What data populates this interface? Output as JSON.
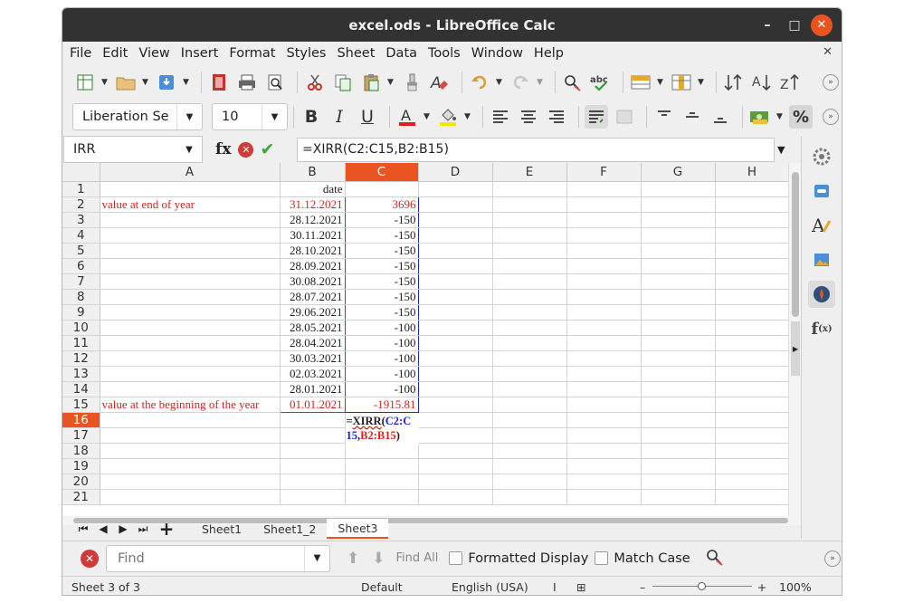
{
  "window": {
    "title": "excel.ods - LibreOffice Calc",
    "minimize": "–",
    "maximize": "□",
    "close": "✕"
  },
  "menu": {
    "items": [
      "File",
      "Edit",
      "View",
      "Insert",
      "Format",
      "Styles",
      "Sheet",
      "Data",
      "Tools",
      "Window",
      "Help"
    ],
    "close": "✕"
  },
  "format_toolbar": {
    "font_name": "Liberation Se",
    "font_size": "10",
    "bold": "B",
    "italic": "I",
    "underline": "U",
    "percent": "%"
  },
  "formula_bar": {
    "name_box": "IRR",
    "fx": "fx",
    "formula": "=XIRR(C2:C15,B2:B15)"
  },
  "grid": {
    "columns": [
      "A",
      "B",
      "C",
      "D",
      "E",
      "F",
      "G",
      "H"
    ],
    "active_column": "C",
    "active_row": "16",
    "rows": [
      {
        "n": "1",
        "a": "",
        "b": "date",
        "c": ""
      },
      {
        "n": "2",
        "a": "value at end of year",
        "b": "31.12.2021",
        "c": "3696"
      },
      {
        "n": "3",
        "a": "",
        "b": "28.12.2021",
        "c": "-150"
      },
      {
        "n": "4",
        "a": "",
        "b": "30.11.2021",
        "c": "-150"
      },
      {
        "n": "5",
        "a": "",
        "b": "28.10.2021",
        "c": "-150"
      },
      {
        "n": "6",
        "a": "",
        "b": "28.09.2021",
        "c": "-150"
      },
      {
        "n": "7",
        "a": "",
        "b": "30.08.2021",
        "c": "-150"
      },
      {
        "n": "8",
        "a": "",
        "b": "28.07.2021",
        "c": "-150"
      },
      {
        "n": "9",
        "a": "",
        "b": "29.06.2021",
        "c": "-150"
      },
      {
        "n": "10",
        "a": "",
        "b": "28.05.2021",
        "c": "-100"
      },
      {
        "n": "11",
        "a": "",
        "b": "28.04.2021",
        "c": "-100"
      },
      {
        "n": "12",
        "a": "",
        "b": "30.03.2021",
        "c": "-100"
      },
      {
        "n": "13",
        "a": "",
        "b": "02.03.2021",
        "c": "-100"
      },
      {
        "n": "14",
        "a": "",
        "b": "28.01.2021",
        "c": "-100"
      },
      {
        "n": "15",
        "a": "value at the beginning of the year",
        "b": "01.01.2021",
        "c": "-1915.81"
      },
      {
        "n": "16",
        "a": "",
        "b": "",
        "c": ""
      },
      {
        "n": "17",
        "a": "",
        "b": "",
        "c": ""
      },
      {
        "n": "18",
        "a": "",
        "b": "",
        "c": ""
      },
      {
        "n": "19",
        "a": "",
        "b": "",
        "c": ""
      },
      {
        "n": "20",
        "a": "",
        "b": "",
        "c": ""
      },
      {
        "n": "21",
        "a": "",
        "b": "",
        "c": ""
      }
    ],
    "edit_cell": {
      "eq": "=",
      "func": "XIRR",
      "open": "(",
      "range1_a": "C2:C",
      "range1_b": "15",
      "comma": ",",
      "range2": "B2:B15",
      "close": ")"
    }
  },
  "sheet_tabs": {
    "add": "+",
    "tabs": [
      "Sheet1",
      "Sheet1_2",
      "Sheet3"
    ],
    "active": "Sheet3"
  },
  "find_bar": {
    "placeholder": "Find",
    "find_all": "Find All",
    "formatted_display": "Formatted Display",
    "match_case": "Match Case"
  },
  "status_bar": {
    "sheet": "Sheet 3 of 3",
    "page_style": "Default",
    "language": "English (USA)",
    "zoom": "100%",
    "zoom_minus": "–",
    "zoom_plus": "+"
  },
  "colors": {
    "accent": "#e95420",
    "red_range": "#d61f1f",
    "blue_range": "#1e24d8",
    "titlebar": "#323232"
  }
}
